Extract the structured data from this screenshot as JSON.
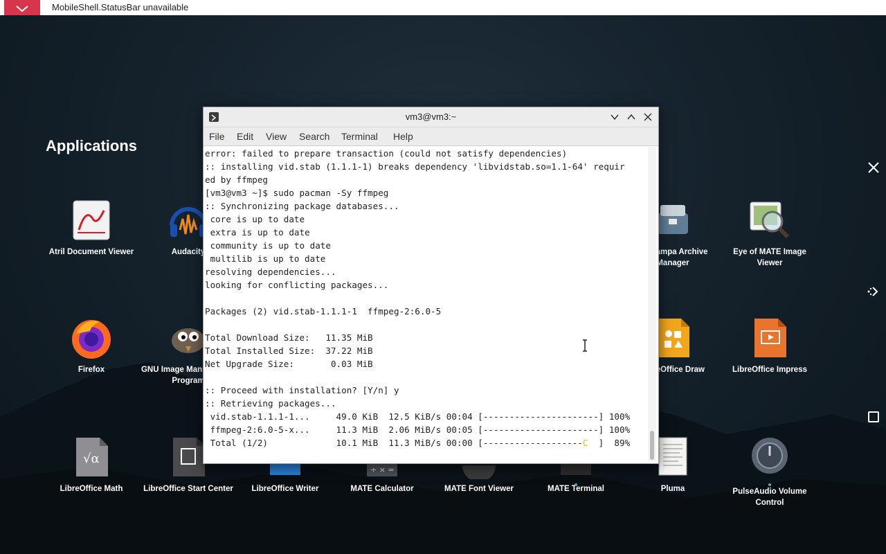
{
  "topbar": {
    "message": "MobileShell.StatusBar unavailable"
  },
  "launcher": {
    "title": "Applications",
    "apps": [
      {
        "label": "Atril Document Viewer",
        "icon": "atril-icon"
      },
      {
        "label": "Audacity",
        "icon": "audacity-icon"
      },
      {
        "label": "Engrampa Archive Manager",
        "icon": "engrampa-icon"
      },
      {
        "label": "Eye of MATE Image Viewer",
        "icon": "eom-icon"
      },
      {
        "label": "Firefox",
        "icon": "firefox-icon"
      },
      {
        "label": "GNU Image Manipulation Program",
        "icon": "gimp-icon"
      },
      {
        "label": "LibreOffice Draw",
        "icon": "libreoffice-draw-icon"
      },
      {
        "label": "LibreOffice Impress",
        "icon": "libreoffice-impress-icon"
      },
      {
        "label": "LibreOffice Math",
        "icon": "libreoffice-math-icon"
      },
      {
        "label": "LibreOffice Start Center",
        "icon": "libreoffice-start-icon"
      },
      {
        "label": "LibreOffice Writer",
        "icon": "libreoffice-writer-icon"
      },
      {
        "label": "MATE Calculator",
        "icon": "calculator-icon"
      },
      {
        "label": "MATE Font Viewer",
        "icon": "font-viewer-icon"
      },
      {
        "label": "MATE Terminal",
        "icon": "terminal-icon"
      },
      {
        "label": "Pluma",
        "icon": "pluma-icon"
      },
      {
        "label": "PulseAudio Volume Control",
        "icon": "pulseaudio-icon"
      }
    ]
  },
  "terminal": {
    "title": "vm3@vm3:~",
    "menu": [
      "File",
      "Edit",
      "View",
      "Search",
      "Terminal",
      "Help"
    ],
    "lines": [
      "error: failed to prepare transaction (could not satisfy dependencies)",
      ":: installing vid.stab (1.1.1-1) breaks dependency 'libvidstab.so=1.1-64' requir",
      "ed by ffmpeg",
      "[vm3@vm3 ~]$ sudo pacman -Sy ffmpeg",
      ":: Synchronizing package databases...",
      " core is up to date",
      " extra is up to date",
      " community is up to date",
      " multilib is up to date",
      "resolving dependencies...",
      "looking for conflicting packages...",
      "",
      "Packages (2) vid.stab-1.1.1-1  ffmpeg-2:6.0-5",
      "",
      "Total Download Size:   11.35 MiB",
      "Total Installed Size:  37.22 MiB",
      "Net Upgrade Size:       0.03 MiB",
      "",
      ":: Proceed with installation? [Y/n] y",
      ":: Retrieving packages...",
      " vid.stab-1.1.1-1...     49.0 KiB  12.5 KiB/s 00:04 [----------------------] 100%",
      " ffmpeg-2:6.0-5-x...     11.3 MiB  2.06 MiB/s 00:05 [----------------------] 100%"
    ],
    "progress_line": {
      "prefix": " Total (1/2)             10.1 MiB  11.3 MiB/s 00:00 [-------------------",
      "marker": "C",
      "suffix": "  ]  89%"
    }
  },
  "colors": {
    "topbar_close": "#d6364b",
    "accent_dot": "#3ab0d8"
  }
}
